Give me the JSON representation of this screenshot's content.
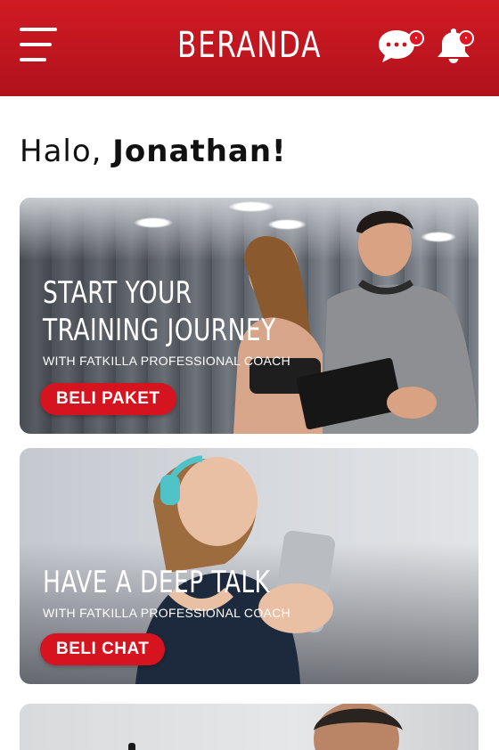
{
  "header": {
    "title": "BERANDA",
    "menu_icon": "hamburger-menu-icon",
    "chat_icon": "chat-bubble-icon",
    "bell_icon": "notification-bell-icon",
    "brand_color": "#c8161f"
  },
  "greeting": {
    "prefix": "Halo,",
    "name": "Jonathan!"
  },
  "cards": [
    {
      "title_line1": "START YOUR",
      "title_line2": "TRAINING JOURNEY",
      "subtitle": "WITH FATKILLA PROFESSIONAL COACH",
      "button": "BELI PAKET"
    },
    {
      "title_line1": "HAVE A DEEP TALK",
      "subtitle": "WITH FATKILLA PROFESSIONAL COACH",
      "button": "BELI CHAT"
    }
  ]
}
